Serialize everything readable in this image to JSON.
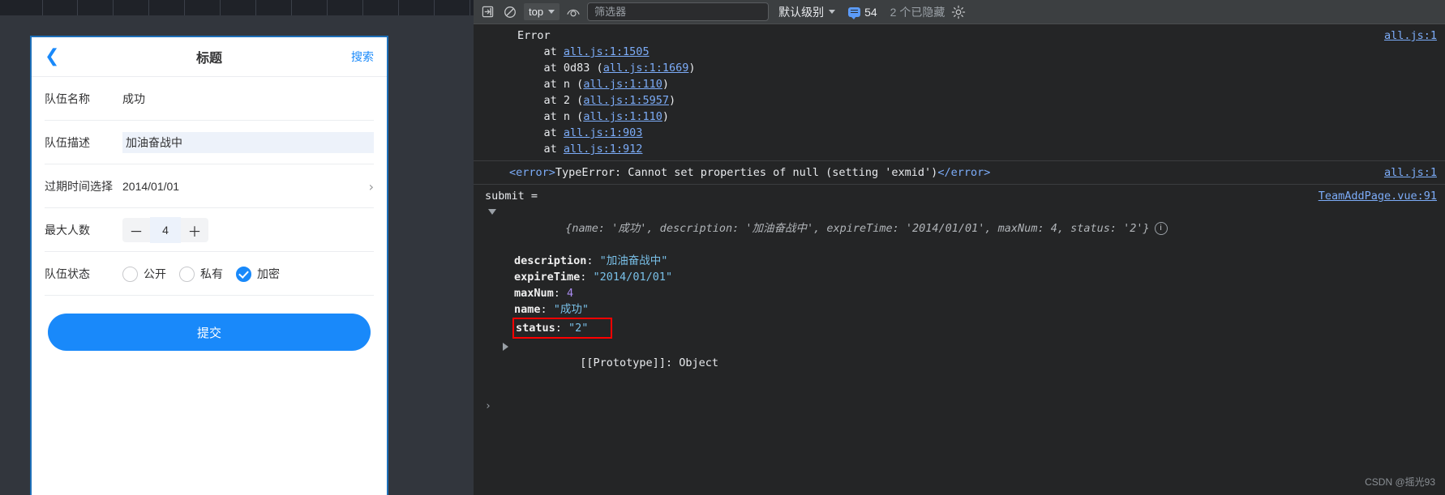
{
  "mobile": {
    "nav": {
      "back_icon": "chevron-left-icon",
      "title": "标题",
      "action": "搜索"
    },
    "fields": [
      {
        "label": "队伍名称",
        "value": "成功"
      },
      {
        "label": "队伍描述",
        "value": "加油奋战中"
      },
      {
        "label": "过期时间选择",
        "value": "2014/01/01",
        "arrow": "›"
      },
      {
        "label": "最大人数",
        "minus": "－",
        "value": "4",
        "plus": "＋"
      },
      {
        "label": "队伍状态"
      }
    ],
    "status_options": [
      {
        "label": "公开",
        "checked": false
      },
      {
        "label": "私有",
        "checked": false
      },
      {
        "label": "加密",
        "checked": true
      }
    ],
    "submit_label": "提交",
    "accent_color": "#1989fa"
  },
  "devtools": {
    "toolbar": {
      "dock_icon": "enter-frame-icon",
      "clear_icon": "clear-console-icon",
      "context": "top",
      "eye_icon": "live-expression-icon",
      "filter_placeholder": "筛选器",
      "filter_value": "",
      "level": "默认级别",
      "issues_count": "54",
      "hidden_text": "2 个已隐藏",
      "settings_icon": "gear-icon"
    },
    "messages": [
      {
        "kind": "error-stack",
        "title": "Error",
        "source": "all.js:1",
        "stack": [
          {
            "prefix": "at ",
            "fn": "",
            "link": "all.js:1:1505",
            "paren": false
          },
          {
            "prefix": "at ",
            "fn": "0d83 ",
            "link": "all.js:1:1669",
            "paren": true
          },
          {
            "prefix": "at ",
            "fn": "n ",
            "link": "all.js:1:110",
            "paren": true
          },
          {
            "prefix": "at ",
            "fn": "2 ",
            "link": "all.js:1:5957",
            "paren": true
          },
          {
            "prefix": "at ",
            "fn": "n ",
            "link": "all.js:1:110",
            "paren": true
          },
          {
            "prefix": "at ",
            "fn": "",
            "link": "all.js:1:903",
            "paren": false
          },
          {
            "prefix": "at ",
            "fn": "",
            "link": "all.js:1:912",
            "paren": false
          }
        ]
      },
      {
        "kind": "error-text",
        "open_tag": "<error>",
        "text": "TypeError: Cannot set properties of null (setting 'exmid')",
        "close_tag": "</error>",
        "source": "all.js:1"
      },
      {
        "kind": "object",
        "label": "submit = ",
        "source": "TeamAddPage.vue:91",
        "preview": "{name: '成功', description: '加油奋战中', expireTime: '2014/01/01', maxNum: 4, status: '2'}",
        "info_badge": "i",
        "props": [
          {
            "key": "description",
            "value": "\"加油奋战中\"",
            "type": "string",
            "highlight": false
          },
          {
            "key": "expireTime",
            "value": "\"2014/01/01\"",
            "type": "string",
            "highlight": false
          },
          {
            "key": "maxNum",
            "value": "4",
            "type": "number",
            "highlight": false
          },
          {
            "key": "name",
            "value": "\"成功\"",
            "type": "string",
            "highlight": false
          },
          {
            "key": "status",
            "value": "\"2\"",
            "type": "string",
            "highlight": true
          }
        ],
        "prototype": "[[Prototype]]: Object"
      }
    ],
    "prompt_symbol": "›"
  },
  "watermark": "CSDN @摇光93"
}
